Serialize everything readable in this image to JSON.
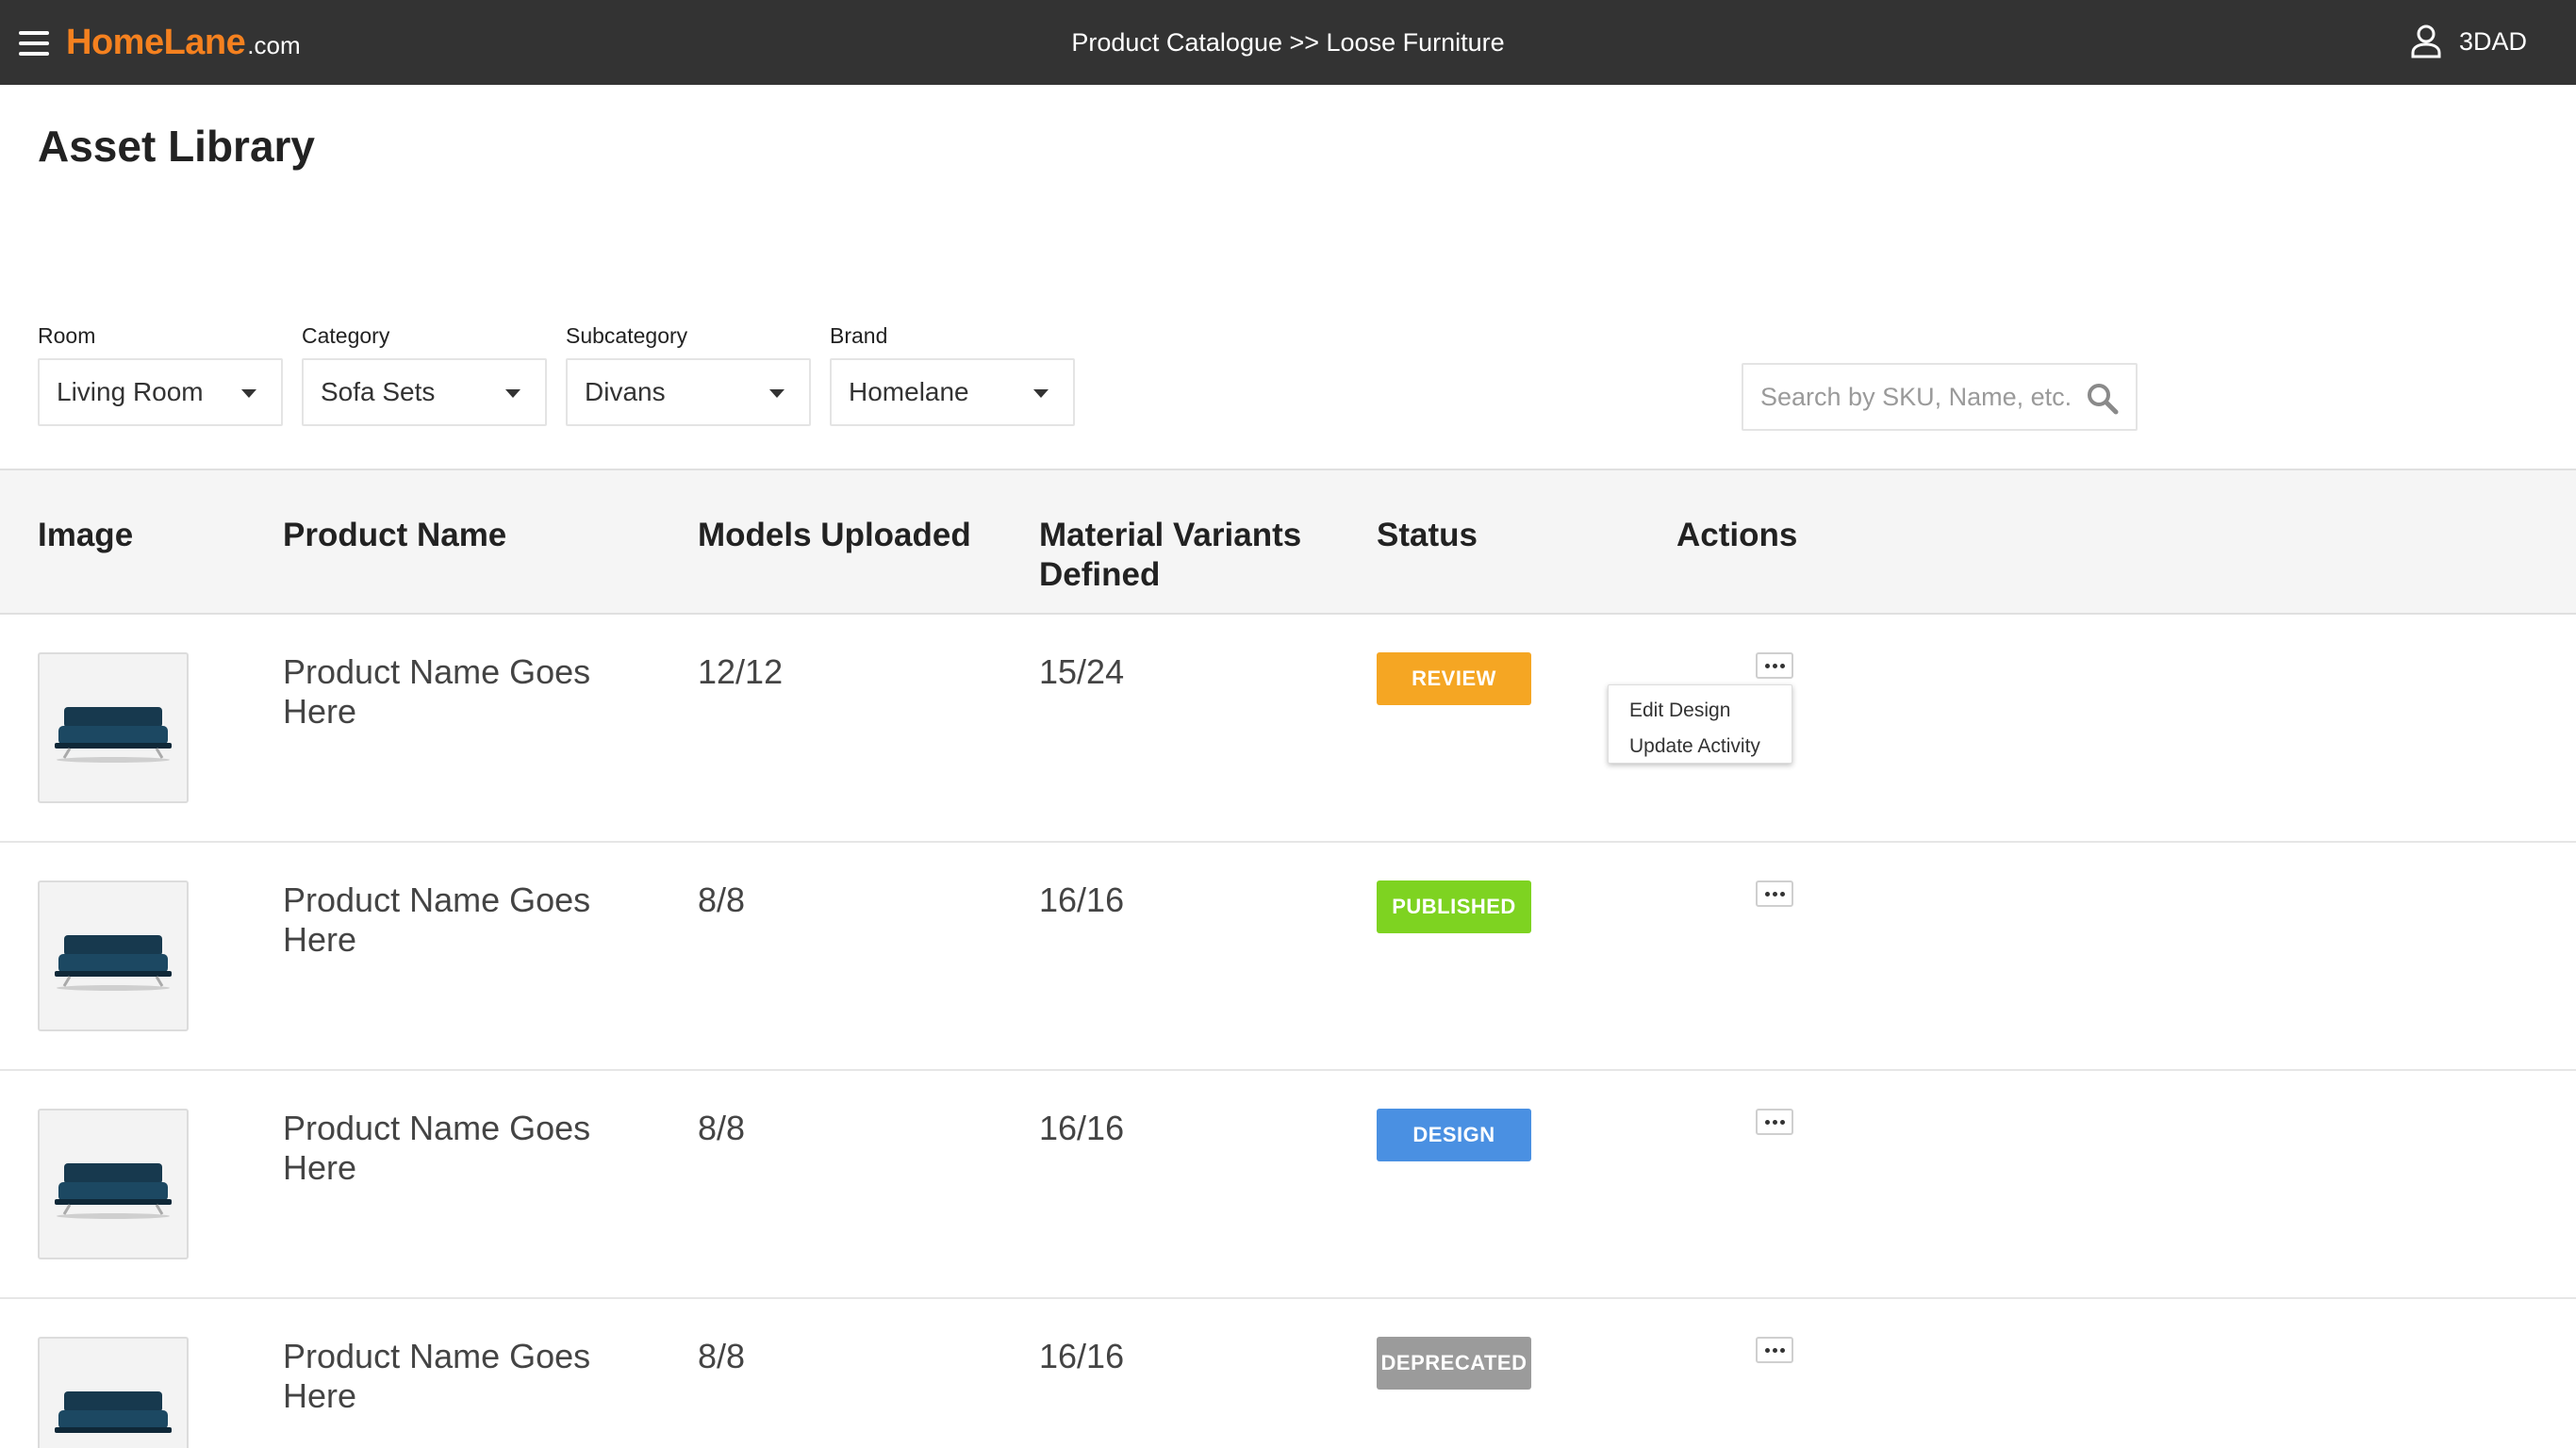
{
  "header": {
    "logo_brand": "HomeLane",
    "logo_domain": ".com",
    "breadcrumb": "Product Catalogue >> Loose Furniture",
    "user_name": "3DAD"
  },
  "page": {
    "title": "Asset Library"
  },
  "filters": [
    {
      "label": "Room",
      "value": "Living Room"
    },
    {
      "label": "Category",
      "value": "Sofa Sets"
    },
    {
      "label": "Subcategory",
      "value": "Divans"
    },
    {
      "label": "Brand",
      "value": "Homelane"
    }
  ],
  "search": {
    "placeholder": "Search by SKU, Name, etc."
  },
  "table": {
    "columns": [
      "Image",
      "Product Name",
      "Models Uploaded",
      "Material Variants Defined",
      "Status",
      "Actions"
    ],
    "rows": [
      {
        "name": "Product Name Goes Here",
        "models": "12/12",
        "variants": "15/24",
        "status": "REVIEW"
      },
      {
        "name": "Product Name Goes Here",
        "models": "8/8",
        "variants": "16/16",
        "status": "PUBLISHED"
      },
      {
        "name": "Product Name Goes Here",
        "models": "8/8",
        "variants": "16/16",
        "status": "DESIGN"
      },
      {
        "name": "Product Name Goes Here",
        "models": "8/8",
        "variants": "16/16",
        "status": "DEPRECATED"
      }
    ]
  },
  "actions_menu": {
    "items": [
      "Edit Design",
      "Update Activity"
    ]
  },
  "colors": {
    "topbar": "#333333",
    "brand_orange": "#f5811f",
    "review": "#f5a623",
    "published": "#7ed321",
    "design": "#4a90e2",
    "deprecated": "#9b9b9b"
  },
  "icons": {
    "menu": "hamburger-icon",
    "user": "user-icon",
    "search": "search-icon",
    "more": "more-horizontal-icon",
    "product": "sofa-image"
  }
}
